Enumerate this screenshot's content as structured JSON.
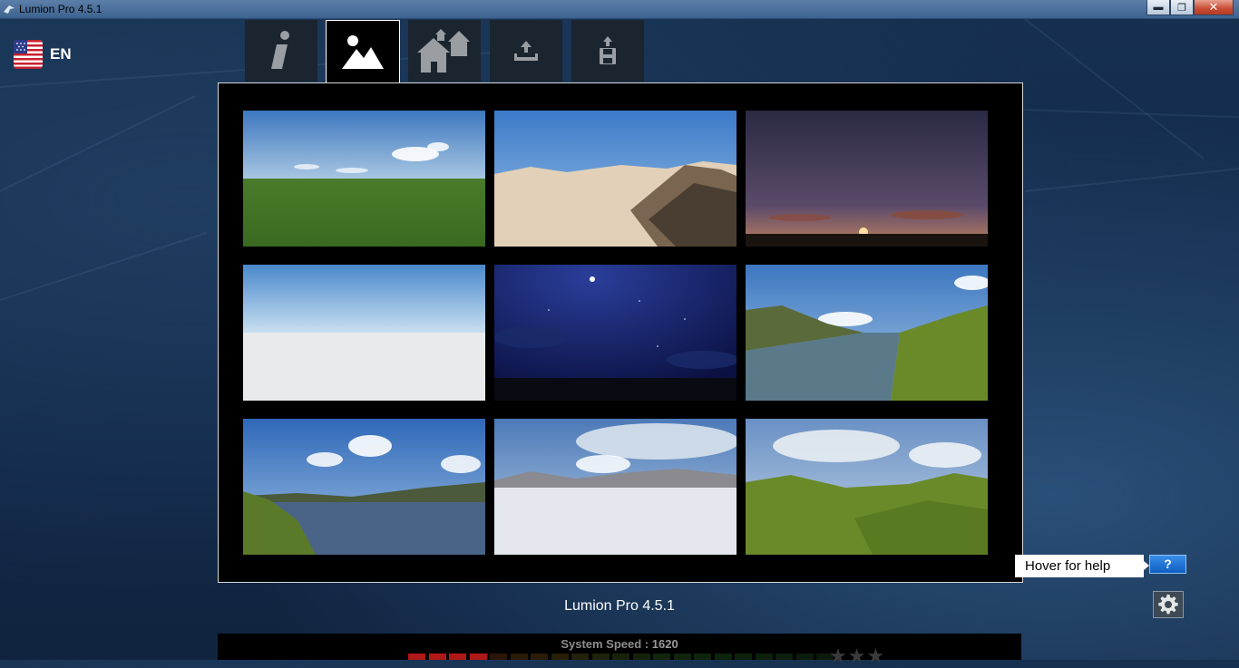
{
  "window": {
    "title": "Lumion Pro 4.5.1",
    "minimize_label": "▬",
    "maximize_label": "❐",
    "close_label": "✕"
  },
  "language": {
    "code": "EN",
    "flag_icon": "us-flag-icon"
  },
  "tabs": [
    {
      "name": "info",
      "icon": "info-icon"
    },
    {
      "name": "landscape",
      "icon": "mountain-icon",
      "active": true
    },
    {
      "name": "example-scenes",
      "icon": "houses-icon"
    },
    {
      "name": "load-scene",
      "icon": "upload-icon"
    },
    {
      "name": "save-scene",
      "icon": "save-icon"
    }
  ],
  "scenes": [
    {
      "name": "grassland"
    },
    {
      "name": "desert"
    },
    {
      "name": "sunset"
    },
    {
      "name": "white-plane"
    },
    {
      "name": "night-sky"
    },
    {
      "name": "river-valley"
    },
    {
      "name": "lake-coast"
    },
    {
      "name": "snow-field"
    },
    {
      "name": "green-hills"
    }
  ],
  "footer": {
    "version_label": "Lumion Pro 4.5.1",
    "help_text": "Hover for help",
    "help_button_label": "?",
    "speed_label": "System Speed :",
    "speed_value": "1620",
    "speed_level_fraction": 0.19,
    "star_rating": {
      "filled": 0,
      "max": 3
    }
  },
  "colors": {
    "accent_blue": "#0d5fc2",
    "speed_red": "#b01818",
    "speed_dim": "#2a1a0a"
  }
}
